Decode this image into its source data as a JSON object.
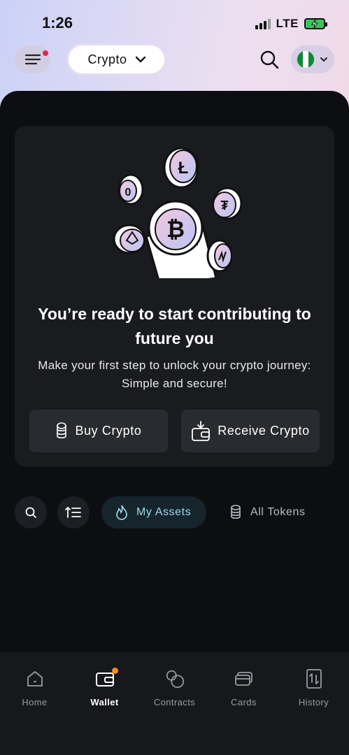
{
  "status": {
    "time": "1:26",
    "network": "LTE"
  },
  "header": {
    "selector_label": "Crypto"
  },
  "hero": {
    "title": "You’re ready to start contributing to future you",
    "subtitle": "Make your first step to unlock your crypto journey: Simple and secure!",
    "buy_label": "Buy Crypto",
    "receive_label": "Receive Crypto"
  },
  "filters": {
    "my_assets": "My Assets",
    "all_tokens": "All Tokens"
  },
  "nav": [
    {
      "label": "Home"
    },
    {
      "label": "Wallet"
    },
    {
      "label": "Contracts"
    },
    {
      "label": "Cards"
    },
    {
      "label": "History"
    }
  ],
  "colors": {
    "accent_dot": "#e6244f",
    "wallet_dot": "#f28b1b",
    "active_pill_text": "#9fd7e8"
  }
}
